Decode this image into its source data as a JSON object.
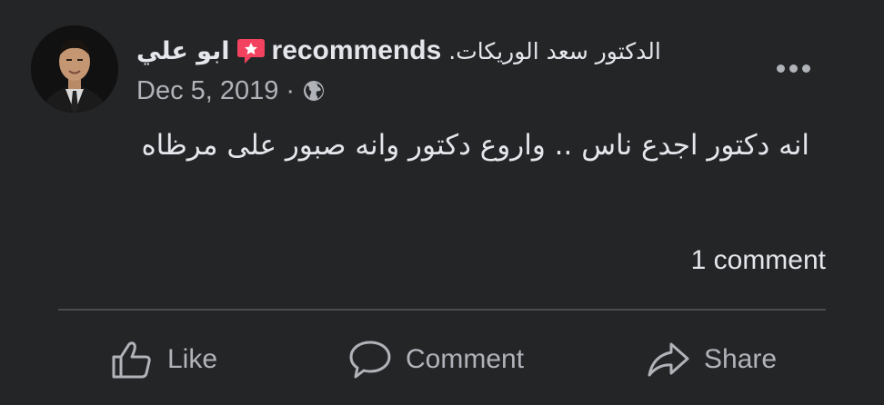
{
  "post": {
    "author_name": "ابو علي",
    "recommend_verb": "recommends",
    "page_name": ".الدكتور سعد الوريكات",
    "date": "Dec 5, 2019",
    "separator": "·",
    "privacy_icon": "globe-icon",
    "body_text": "انه دكتور اجدع ناس .. واروع دكتور وانه صبور على مرظاه",
    "comment_count_label": "1 comment"
  },
  "actions": {
    "like_label": "Like",
    "comment_label": "Comment",
    "share_label": "Share"
  },
  "colors": {
    "background": "#242527",
    "primary_text": "#e4e6eb",
    "secondary_text": "#b0b3b8",
    "recommend_badge": "#f3425f",
    "divider": "#4a4c50"
  }
}
